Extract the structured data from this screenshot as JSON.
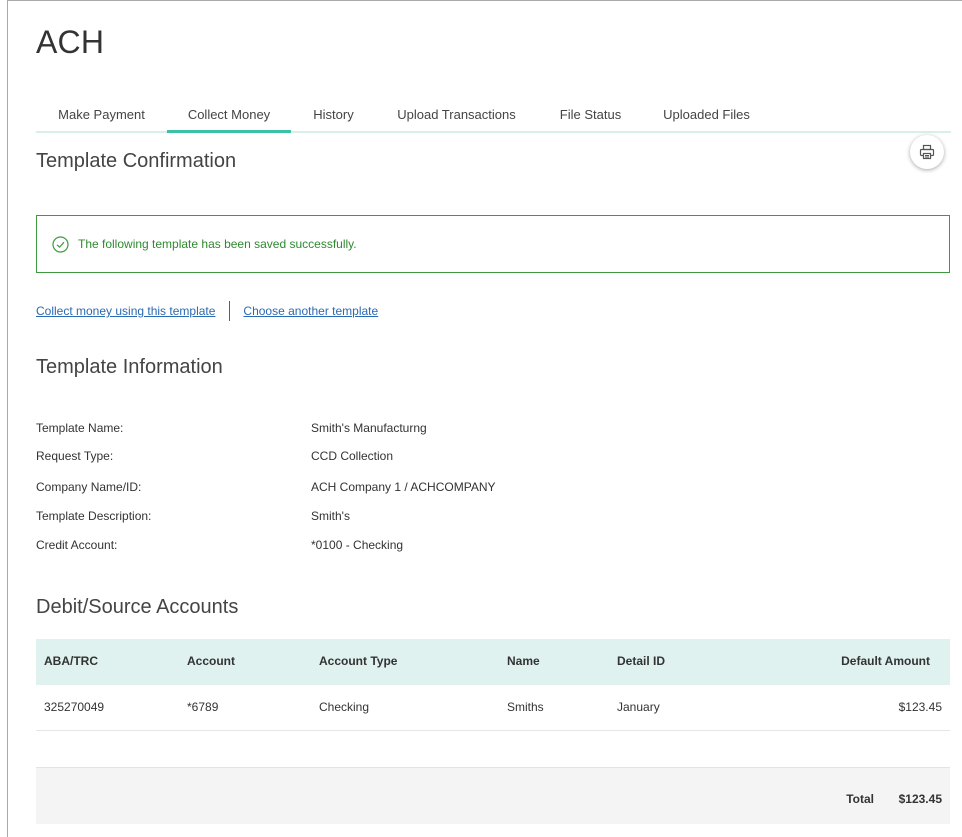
{
  "app": {
    "title": "ACH"
  },
  "tabs": [
    {
      "label": "Make Payment",
      "active": false
    },
    {
      "label": "Collect Money",
      "active": true
    },
    {
      "label": "History",
      "active": false
    },
    {
      "label": "Upload Transactions",
      "active": false
    },
    {
      "label": "File Status",
      "active": false
    },
    {
      "label": "Uploaded Files",
      "active": false
    }
  ],
  "confirmation": {
    "title": "Template Confirmation",
    "print_icon": "printer-icon",
    "alert_icon": "check-circle-icon",
    "alert_message": "The following template has been saved successfully.",
    "alert_color": "#3f9a3f"
  },
  "links": {
    "collect": "Collect money using this template",
    "choose": "Choose another template"
  },
  "template_info": {
    "title": "Template Information",
    "rows": [
      {
        "label": "Template Name:",
        "value": "Smith's Manufacturng"
      },
      {
        "label": "Request Type:",
        "value": "CCD Collection"
      },
      {
        "label": "Company Name/ID:",
        "value": "ACH Company 1 / ACHCOMPANY"
      },
      {
        "label": "Template Description:",
        "value": "Smith's"
      },
      {
        "label": "Credit Account:",
        "value": "*0100 - Checking"
      }
    ]
  },
  "accounts": {
    "title": "Debit/Source Accounts",
    "columns": [
      "ABA/TRC",
      "Account",
      "Account Type",
      "Name",
      "Detail ID",
      "Default Amount"
    ],
    "rows": [
      [
        "325270049",
        "*6789",
        "Checking",
        "Smiths",
        "January",
        "$123.45"
      ]
    ],
    "total_label": "Total",
    "total_value": "$123.45"
  },
  "colors": {
    "accent": "#3cc1a8",
    "table_header_bg": "#dff2ef",
    "link": "#2a6ab3",
    "success": "#2f8a2f"
  }
}
